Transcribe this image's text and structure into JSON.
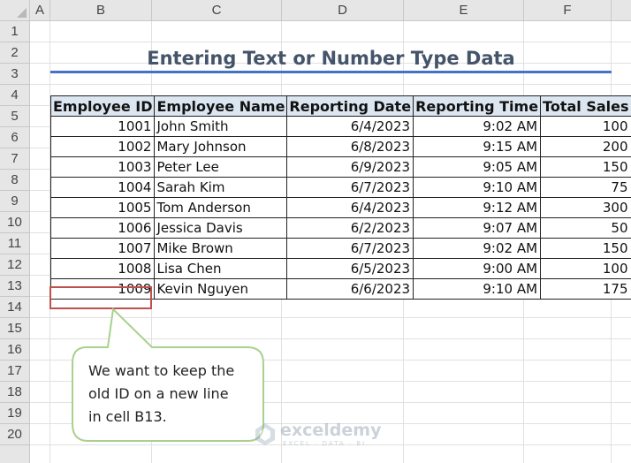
{
  "sheet": {
    "columns": [
      "A",
      "B",
      "C",
      "D",
      "E",
      "F"
    ],
    "rows": [
      "1",
      "2",
      "3",
      "4",
      "5",
      "6",
      "7",
      "8",
      "9",
      "10",
      "11",
      "12",
      "13",
      "14",
      "15",
      "16",
      "17",
      "18",
      "19",
      "20"
    ],
    "selected_cell": "B13"
  },
  "title": "Entering Text or Number Type Data",
  "table": {
    "headers": [
      "Employee ID",
      "Employee Name",
      "Reporting Date",
      "Reporting Time",
      "Total Sales"
    ],
    "rows": [
      [
        "1001",
        "John Smith",
        "6/4/2023",
        "9:02 AM",
        "100"
      ],
      [
        "1002",
        "Mary Johnson",
        "6/8/2023",
        "9:15 AM",
        "200"
      ],
      [
        "1003",
        "Peter Lee",
        "6/9/2023",
        "9:05 AM",
        "150"
      ],
      [
        "1004",
        "Sarah Kim",
        "6/7/2023",
        "9:10 AM",
        "75"
      ],
      [
        "1005",
        "Tom Anderson",
        "6/4/2023",
        "9:12 AM",
        "300"
      ],
      [
        "1006",
        "Jessica Davis",
        "6/2/2023",
        "9:07 AM",
        "50"
      ],
      [
        "1007",
        "Mike Brown",
        "6/7/2023",
        "9:02 AM",
        "150"
      ],
      [
        "1008",
        "Lisa Chen",
        "6/5/2023",
        "9:00 AM",
        "100"
      ],
      [
        "1009",
        "Kevin Nguyen",
        "6/6/2023",
        "9:10 AM",
        "175"
      ]
    ]
  },
  "callout": {
    "lines": [
      "We want to keep the",
      "old ID on a new line",
      "in cell B13."
    ]
  },
  "watermark": {
    "name": "exceldemy",
    "tagline": "EXCEL · DATA · BI"
  },
  "colors": {
    "title": "#44546a",
    "underline": "#4472c4",
    "header_fill": "#dce6f1",
    "selection": "#c0504d",
    "callout_border": "#a9d18e"
  }
}
